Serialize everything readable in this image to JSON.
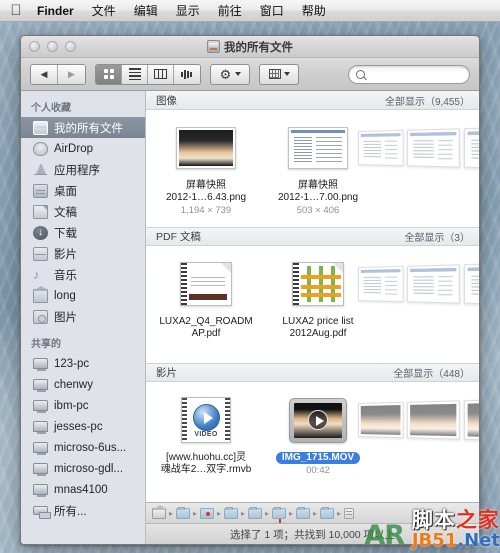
{
  "menubar": {
    "apple_icon": "apple-logo",
    "items": [
      {
        "label": "Finder",
        "bold": true
      },
      {
        "label": "文件"
      },
      {
        "label": "编辑"
      },
      {
        "label": "显示"
      },
      {
        "label": "前往"
      },
      {
        "label": "窗口"
      },
      {
        "label": "帮助"
      }
    ]
  },
  "window": {
    "title": "我的所有文件",
    "traffic": [
      "close-button",
      "minimize-button",
      "zoom-button"
    ]
  },
  "toolbar": {
    "back_label": "◀",
    "forward_label": "▶",
    "view_modes": [
      {
        "name": "icon-view",
        "active": true
      },
      {
        "name": "list-view",
        "active": false
      },
      {
        "name": "column-view",
        "active": false
      },
      {
        "name": "coverflow-view",
        "active": false
      }
    ],
    "action_menu": "gear-icon",
    "arrange_menu": "arrange-icon",
    "search": {
      "value": "",
      "placeholder": ""
    }
  },
  "sidebar": {
    "sections": [
      {
        "header": "个人收藏",
        "items": [
          {
            "label": "我的所有文件",
            "icon": "si-allfiles",
            "selected": true
          },
          {
            "label": "AirDrop",
            "icon": "si-airdrop",
            "selected": false
          },
          {
            "label": "应用程序",
            "icon": "si-apps",
            "selected": false
          },
          {
            "label": "桌面",
            "icon": "si-desktop",
            "selected": false
          },
          {
            "label": "文稿",
            "icon": "si-docs",
            "selected": false
          },
          {
            "label": "下载",
            "icon": "si-downloads",
            "selected": false
          },
          {
            "label": "影片",
            "icon": "si-movies",
            "selected": false
          },
          {
            "label": "音乐",
            "icon": "si-music",
            "selected": false
          },
          {
            "label": "long",
            "icon": "si-home",
            "selected": false
          },
          {
            "label": "图片",
            "icon": "si-pictures",
            "selected": false
          }
        ]
      },
      {
        "header": "共享的",
        "items": [
          {
            "label": "123-pc",
            "icon": "si-pc",
            "selected": false
          },
          {
            "label": "chenwy",
            "icon": "si-pc",
            "selected": false
          },
          {
            "label": "ibm-pc",
            "icon": "si-pc",
            "selected": false
          },
          {
            "label": "jesses-pc",
            "icon": "si-pc",
            "selected": false
          },
          {
            "label": "microso-6us...",
            "icon": "si-pc",
            "selected": false
          },
          {
            "label": "microso-gdl...",
            "icon": "si-pc",
            "selected": false
          },
          {
            "label": "mnas4100",
            "icon": "si-pc",
            "selected": false
          },
          {
            "label": "所有...",
            "icon": "si-allnet",
            "selected": false
          }
        ]
      }
    ]
  },
  "groups": [
    {
      "title": "图像",
      "show_all": "全部显示（9,455）",
      "items": [
        {
          "name_line1": "屏幕快照",
          "name_line2": "2012-1…6.43.png",
          "meta": "1,194 × 739",
          "thumb": "screenshot-dark",
          "selected": false
        },
        {
          "name_line1": "屏幕快照",
          "name_line2": "2012-1…7.00.png",
          "meta": "503 × 406",
          "thumb": "screenshot-window",
          "selected": false
        },
        {
          "name_line1": "",
          "name_line2": "",
          "meta": "",
          "thumb": "stack-preview",
          "selected": false
        }
      ]
    },
    {
      "title": "PDF 文稿",
      "show_all": "全部显示（3）",
      "items": [
        {
          "name_line1": "LUXA2_Q4_ROADM",
          "name_line2": "AP.pdf",
          "meta": "",
          "thumb": "pdf-roadmap",
          "selected": false
        },
        {
          "name_line1": "LUXA2 price list",
          "name_line2": "2012Aug.pdf",
          "meta": "",
          "thumb": "pdf-pricelist",
          "selected": false
        },
        {
          "name_line1": "",
          "name_line2": "",
          "meta": "",
          "thumb": "stack-preview",
          "selected": false
        }
      ]
    },
    {
      "title": "影片",
      "show_all": "全部显示（448）",
      "items": [
        {
          "name_line1": "[www.huohu.cc]灵",
          "name_line2": "魂战车2…双字.rmvb",
          "meta": "",
          "thumb": "video-rmvb",
          "selected": false
        },
        {
          "name_line1": "",
          "name_line2": "IMG_1715.MOV",
          "meta": "00:42",
          "thumb": "video-mov",
          "selected": true
        },
        {
          "name_line1": "",
          "name_line2": "",
          "meta": "",
          "thumb": "stack-preview",
          "selected": false
        }
      ]
    }
  ],
  "pathbar": {
    "segments": [
      {
        "name": "path-home",
        "icon": "pf-home"
      },
      {
        "name": "path-folder-1",
        "icon": "pf-folder"
      },
      {
        "name": "path-folder-recording",
        "icon": "pf-rec"
      },
      {
        "name": "path-folder-2",
        "icon": "pf-folder"
      },
      {
        "name": "path-folder-3",
        "icon": "pf-folder"
      },
      {
        "name": "path-folder-4",
        "icon": "pf-folder"
      },
      {
        "name": "path-folder-5",
        "icon": "pf-folder"
      },
      {
        "name": "path-folder-6",
        "icon": "pf-folder"
      },
      {
        "name": "path-file",
        "icon": "pf-doc"
      }
    ],
    "separator": "▸"
  },
  "statusbar": {
    "text": "选择了 1 项；共找到 10,000 项以上"
  },
  "watermark": {
    "top_part1": "脚本",
    "top_part2": "之家",
    "bottom_part1": "JB51",
    "bottom_part2": ".Net",
    "side": "AR"
  },
  "colors": {
    "selection_blue": "#3b7de0",
    "sidebar_selected": "#8c96a3",
    "accent_red": "#e03020",
    "accent_orange": "#f07a18"
  }
}
